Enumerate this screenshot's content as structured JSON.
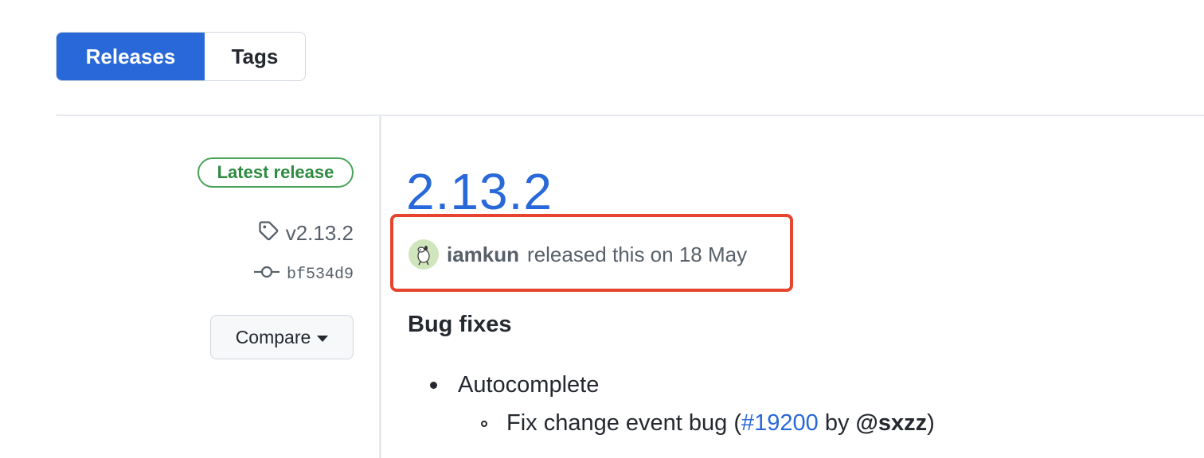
{
  "tabs": {
    "releases": "Releases",
    "tags": "Tags"
  },
  "release": {
    "badge": "Latest release",
    "tag": "v2.13.2",
    "commit": "bf534d9",
    "compare_label": "Compare",
    "title": "2.13.2",
    "author": "iamkun",
    "released_text": "released this on 18 May",
    "section_heading": "Bug fixes",
    "item": "Autocomplete",
    "subitem": {
      "prefix": "Fix change event bug (",
      "issue": "#19200",
      "by": " by ",
      "mention": "@sxzz",
      "suffix": ")"
    }
  },
  "colors": {
    "accent": "#2868d8",
    "badge_green": "#4aa35a",
    "highlight_red": "#e5452f"
  },
  "icons": {
    "tag": "tag-icon",
    "commit": "git-commit-icon",
    "caret": "caret-down-icon",
    "avatar": "avatar"
  }
}
